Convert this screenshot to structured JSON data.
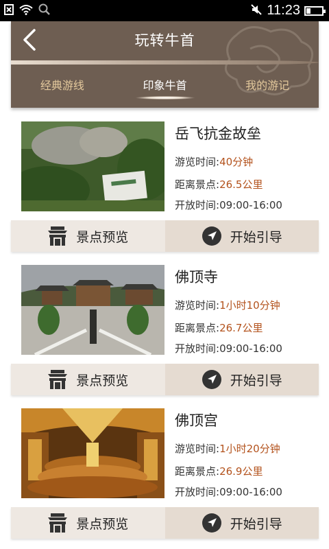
{
  "status_bar": {
    "time": "11:23",
    "icons": [
      "sim-off-icon",
      "wifi-icon",
      "search-icon",
      "mute-icon",
      "battery-icon"
    ]
  },
  "header": {
    "title": "玩转牛首",
    "back_icon": "chevron-left-icon",
    "tabs": [
      {
        "label": "经典游线",
        "active": false
      },
      {
        "label": "印象牛首",
        "active": true
      },
      {
        "label": "我的游记",
        "active": false
      }
    ]
  },
  "labels": {
    "tour_time": "游览时间:",
    "distance": "距离景点:",
    "open_time": "开放时间:",
    "preview": "景点预览",
    "guide": "开始引导"
  },
  "spots": [
    {
      "name": "岳飞抗金故垒",
      "tour_time": "40分钟",
      "distance": "26.5公里",
      "open_time": "09:00-16:00"
    },
    {
      "name": "佛顶寺",
      "tour_time": "1小时10分钟",
      "distance": "26.7公里",
      "open_time": "09:00-16:00"
    },
    {
      "name": "佛顶宫",
      "tour_time": "1小时20分钟",
      "distance": "26.9公里",
      "open_time": "09:00-16:00"
    }
  ],
  "colors": {
    "header_bg": "#6e5e52",
    "tab_inactive": "#e3c89c",
    "value_highlight": "#b3521c",
    "preview_bg": "#eee8e2",
    "guide_bg": "#e5dbd1"
  }
}
